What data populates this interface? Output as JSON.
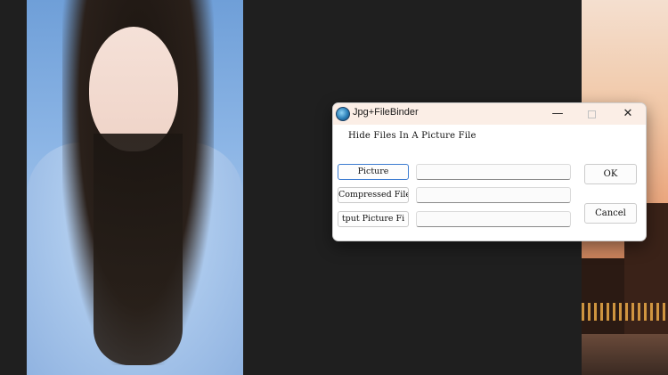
{
  "window": {
    "title": "Jpg+FileBinder",
    "minimize": "—",
    "close": "✕"
  },
  "dialog": {
    "heading": "Hide Files In A Picture File",
    "fields": [
      {
        "button_label": "Picture",
        "value": ""
      },
      {
        "button_label": "Compressed File",
        "value": ""
      },
      {
        "button_label": "tput Picture Fi",
        "value": ""
      }
    ],
    "ok_label": "OK",
    "cancel_label": "Cancel"
  },
  "icons": {
    "app": "app-icon",
    "minimize": "minimize-icon",
    "maximize": "maximize-icon",
    "close": "close-icon"
  }
}
